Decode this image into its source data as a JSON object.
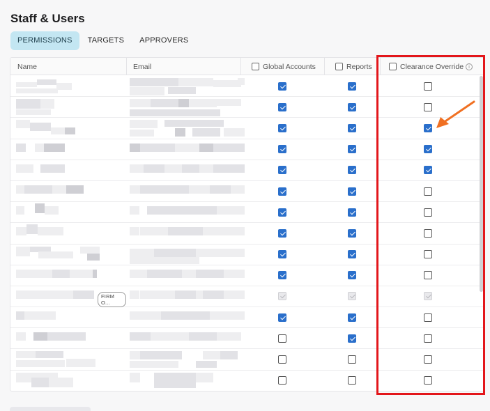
{
  "page": {
    "title": "Staff & Users"
  },
  "tabs": [
    {
      "label": "PERMISSIONS",
      "active": true
    },
    {
      "label": "TARGETS",
      "active": false
    },
    {
      "label": "APPROVERS",
      "active": false
    }
  ],
  "table": {
    "headers": {
      "name": "Name",
      "email": "Email",
      "global_accounts": "Global Accounts",
      "reports": "Reports",
      "clearance_override": "Clearance Override"
    },
    "rows": [
      {
        "global_accounts": "checked",
        "reports": "checked",
        "clearance_override": "unchecked"
      },
      {
        "global_accounts": "checked",
        "reports": "checked",
        "clearance_override": "unchecked"
      },
      {
        "global_accounts": "checked",
        "reports": "checked",
        "clearance_override": "checked"
      },
      {
        "global_accounts": "checked",
        "reports": "checked",
        "clearance_override": "checked"
      },
      {
        "global_accounts": "checked",
        "reports": "checked",
        "clearance_override": "checked"
      },
      {
        "global_accounts": "checked",
        "reports": "checked",
        "clearance_override": "unchecked"
      },
      {
        "global_accounts": "checked",
        "reports": "checked",
        "clearance_override": "unchecked"
      },
      {
        "global_accounts": "checked",
        "reports": "checked",
        "clearance_override": "unchecked"
      },
      {
        "global_accounts": "checked",
        "reports": "checked",
        "clearance_override": "unchecked"
      },
      {
        "global_accounts": "checked",
        "reports": "checked",
        "clearance_override": "unchecked"
      },
      {
        "global_accounts": "disabled",
        "reports": "disabled",
        "clearance_override": "disabled",
        "badge": "FIRM O..."
      },
      {
        "global_accounts": "checked",
        "reports": "checked",
        "clearance_override": "unchecked"
      },
      {
        "global_accounts": "unchecked",
        "reports": "checked",
        "clearance_override": "unchecked"
      },
      {
        "global_accounts": "unchecked",
        "reports": "unchecked",
        "clearance_override": "unchecked"
      },
      {
        "global_accounts": "unchecked",
        "reports": "unchecked",
        "clearance_override": "unchecked"
      }
    ]
  },
  "annotation": {
    "highlight_color": "#e3161b",
    "arrow_color": "#f07022"
  },
  "icons": {
    "info": "info-icon",
    "arrow": "arrow-annotation-icon"
  }
}
